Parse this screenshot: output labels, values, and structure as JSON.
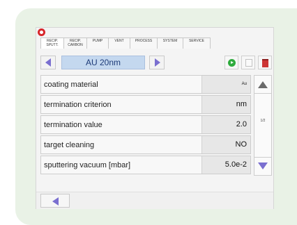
{
  "tabs": [
    {
      "line1": "recip.",
      "line2": "SPUTT."
    },
    {
      "line1": "recip.",
      "line2": "CARBON"
    },
    {
      "line1": "PUMP",
      "line2": ""
    },
    {
      "line1": "VENT",
      "line2": ""
    },
    {
      "line1": "PROCESS",
      "line2": ""
    },
    {
      "line1": "SYSTEM",
      "line2": ""
    },
    {
      "line1": "SERVICE",
      "line2": ""
    }
  ],
  "program": {
    "name": "AU 20nm"
  },
  "parameters": [
    {
      "label": "coating material",
      "value": "Au"
    },
    {
      "label": "termination criterion",
      "value": "nm"
    },
    {
      "label": "termination value",
      "value": "2.0"
    },
    {
      "label": "target cleaning",
      "value": "NO"
    },
    {
      "label": "sputtering vacuum  [mbar]",
      "value": "5.0e-2"
    }
  ],
  "scroll": {
    "indicator": "1/2"
  },
  "icons": {
    "prev": "triangle-left-icon",
    "next": "triangle-right-icon",
    "start": "green-play-icon",
    "copy": "copy-icon",
    "delete": "trash-icon",
    "scroll_up": "triangle-up-icon",
    "scroll_down": "triangle-down-icon",
    "back": "back-arrow-icon"
  },
  "colors": {
    "accent": "#7a6fd0",
    "program_bg": "#c4d8ef",
    "start": "#2eab3d",
    "delete": "#cc3434",
    "frame": "#e9f2e6"
  }
}
